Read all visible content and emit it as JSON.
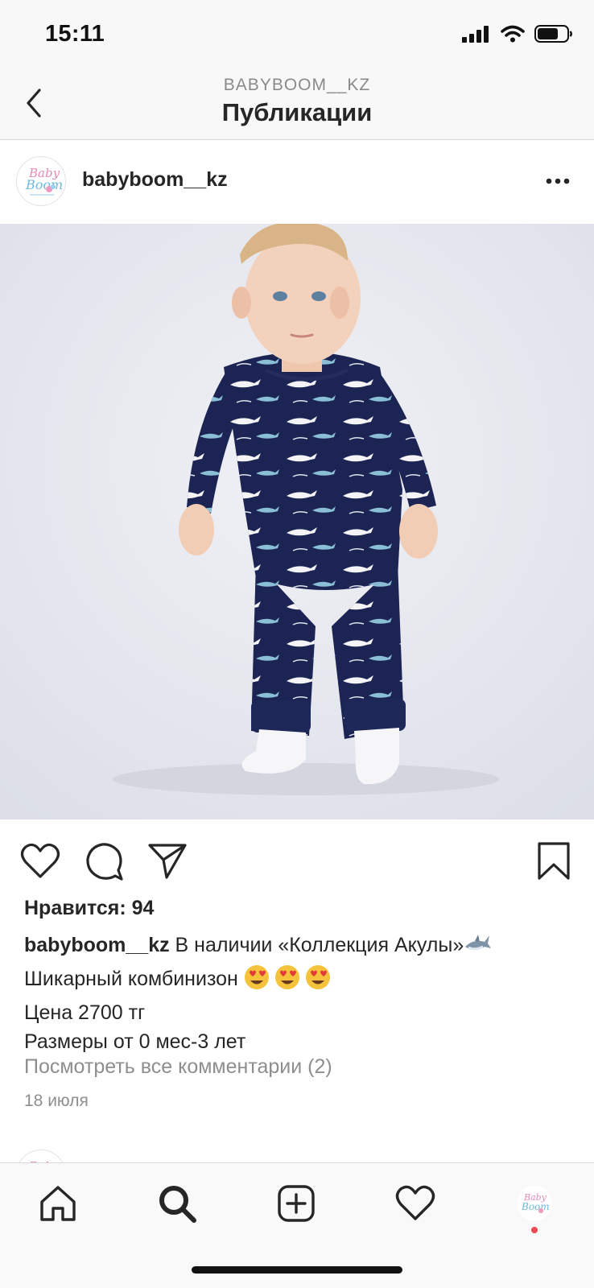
{
  "status_bar": {
    "time": "15:11"
  },
  "nav": {
    "subtitle": "BABYBOOM__KZ",
    "title": "Публикации"
  },
  "post": {
    "username": "babyboom__kz",
    "avatar_logo": "Baby Boom",
    "likes": "Нравится: 94",
    "caption": {
      "user": "babyboom__kz",
      "line1": " В наличии «Коллекция Акулы»",
      "line1_emoji": "shark-emoji",
      "line2": "Шикарный комбинизон ",
      "line2_emoji": "heart-eyes-emoji x3",
      "line3": "Цена 2700  тг",
      "line4": "Размеры от 0 мес-3 лет"
    },
    "view_comments": "Посмотреть все комментарии (2)",
    "date": "18 июля"
  },
  "actions": {
    "like_icon": "heart-icon",
    "comment_icon": "comment-icon",
    "share_icon": "paper-plane-icon",
    "save_icon": "bookmark-icon"
  },
  "tab_bar": {
    "items": [
      "home-icon",
      "search-icon",
      "add-post-icon",
      "activity-heart-icon",
      "profile-avatar"
    ]
  },
  "colors": {
    "background": "#ffffff",
    "bars": "#f8f8f8",
    "text": "#262626",
    "secondary_text": "#8e8e8e",
    "notification": "#ed4956",
    "outfit_navy": "#1b2452"
  }
}
